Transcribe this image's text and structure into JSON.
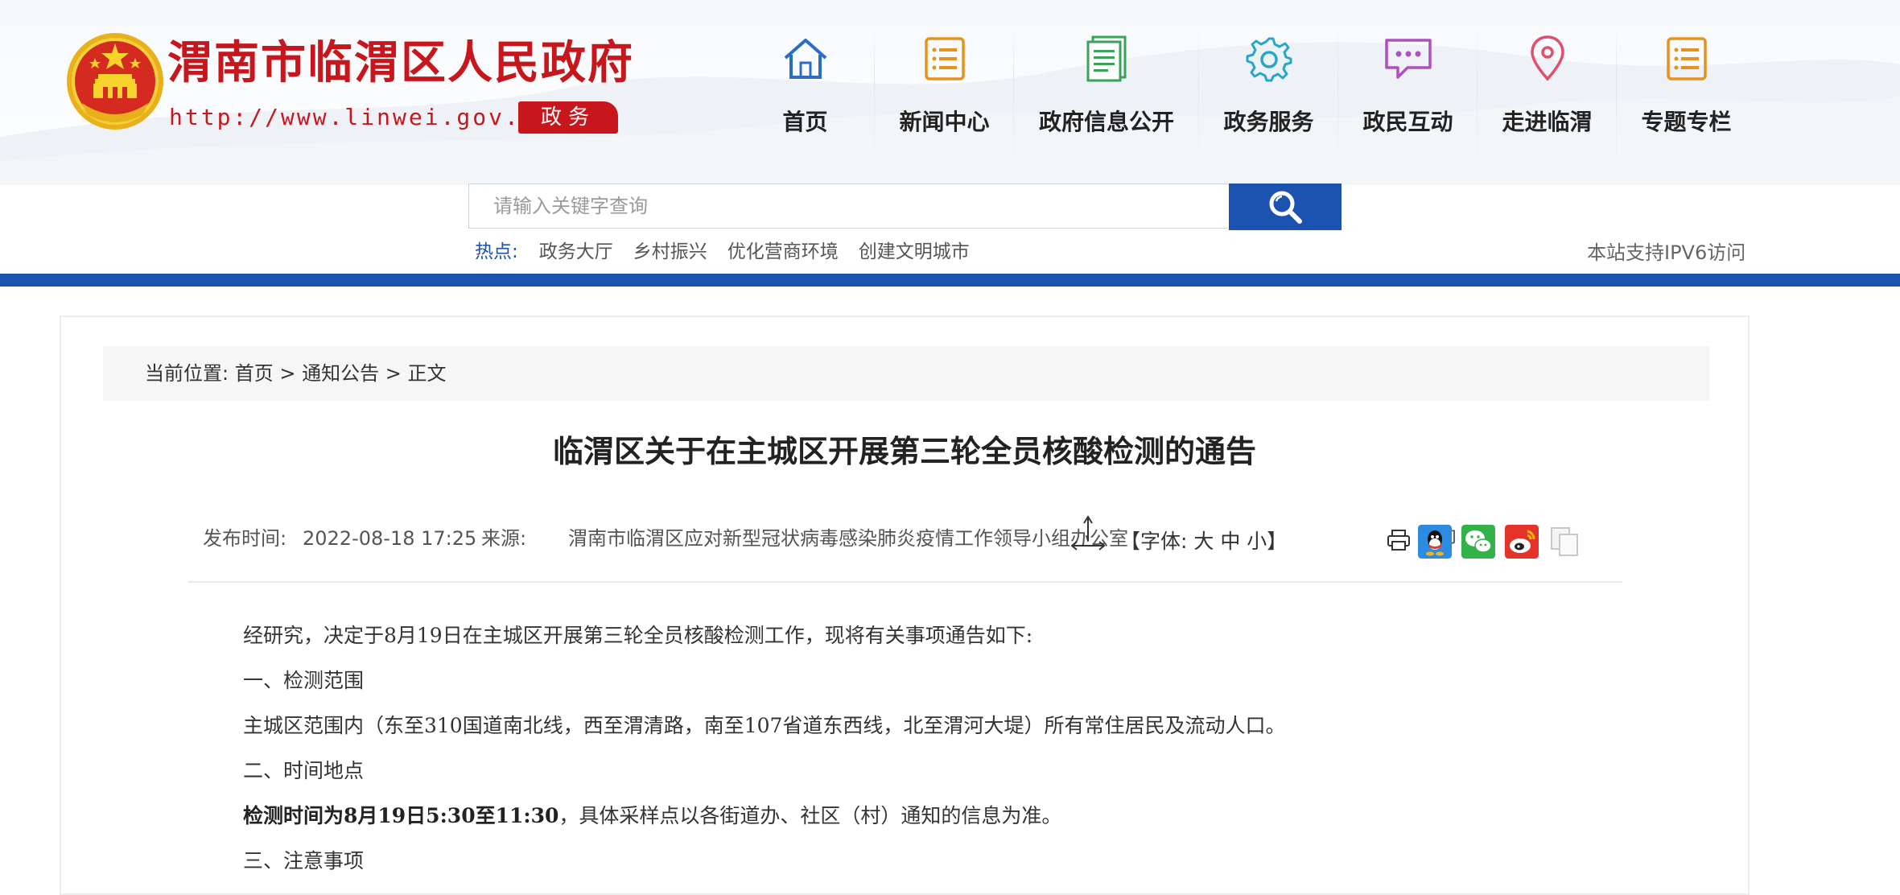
{
  "site": {
    "title": "渭南市临渭区人民政府",
    "url": "http://www.linwei.gov.cn",
    "badge": "政务",
    "brand_color": "#c8161d",
    "accent_color": "#1c53b1"
  },
  "nav": [
    {
      "label": "首页",
      "icon": "home-icon"
    },
    {
      "label": "新闻中心",
      "icon": "news-list-icon"
    },
    {
      "label": "政府信息公开",
      "icon": "document-icon"
    },
    {
      "label": "政务服务",
      "icon": "gear-icon"
    },
    {
      "label": "政民互动",
      "icon": "chat-bubble-icon"
    },
    {
      "label": "走进临渭",
      "icon": "location-pin-icon"
    },
    {
      "label": "专题专栏",
      "icon": "topic-list-icon"
    }
  ],
  "search": {
    "placeholder": "请输入关键字查询",
    "button_icon": "search-icon"
  },
  "hot": {
    "label": "热点:",
    "links": [
      "政务大厅",
      "乡村振兴",
      "优化营商环境",
      "创建文明城市"
    ]
  },
  "ipv6_note": "本站支持IPV6访问",
  "breadcrumb": {
    "label": "当前位置:",
    "items": [
      "首页",
      "通知公告",
      "正文"
    ],
    "separator": ">"
  },
  "article": {
    "title": "临渭区关于在主城区开展第三轮全员核酸检测的通告",
    "publish_label": "发布时间:",
    "publish_date": "2022-08-18 17:25",
    "source_label": "来源:",
    "source": "渭南市临渭区应对新型冠状病毒感染肺炎疫情工作领导小组办公室",
    "font_control": "【字体: 大 中 小】",
    "print_label": "打印",
    "share_icons": [
      "qq-share-icon",
      "wechat-share-icon",
      "weibo-share-icon",
      "copy-link-icon"
    ],
    "paragraphs": {
      "p1": "经研究，决定于8月19日在主城区开展第三轮全员核酸检测工作，现将有关事项通告如下:",
      "p2": "一、检测范围",
      "p3": "主城区范围内（东至310国道南北线，西至渭清路，南至107省道东西线，北至渭河大堤）所有常住居民及流动人口。",
      "p4": "二、时间地点",
      "p5_bold": "检测时间为8月19日5:30至11:30",
      "p5_rest": "，具体采样点以各街道办、社区（村）通知的信息为准。",
      "p6": "三、注意事项"
    }
  }
}
